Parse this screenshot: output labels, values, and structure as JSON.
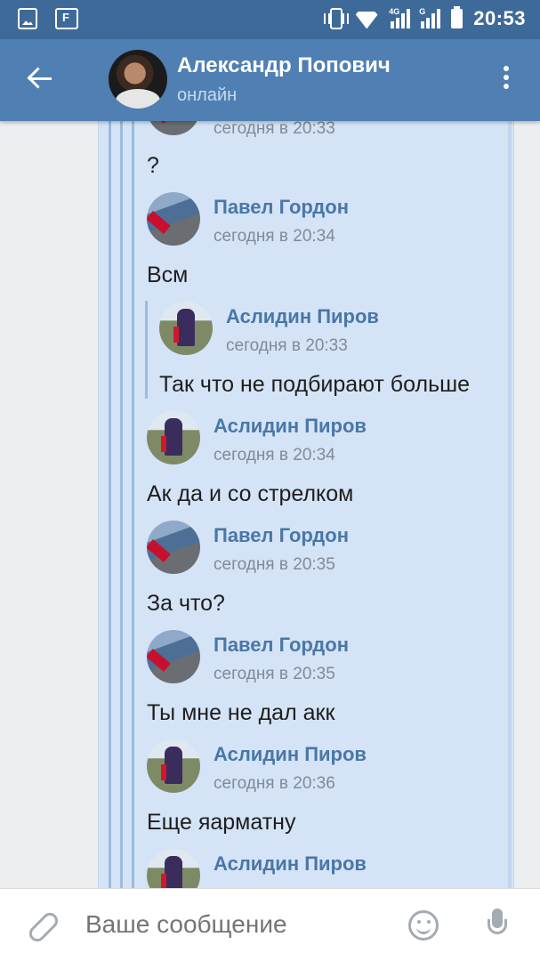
{
  "status_bar": {
    "time": "20:53",
    "network": "4G",
    "network2": "G"
  },
  "header": {
    "name": "Александр Попович",
    "status": "онлайн"
  },
  "messages": [
    {
      "author": "",
      "time": "сегодня в 20:33",
      "text": "?"
    },
    {
      "author": "Павел Гордон",
      "time": "сегодня в 20:34",
      "text": "Всм"
    },
    {
      "author": "Аслидин Пиров",
      "time": "сегодня в 20:33",
      "text": "Так что не подбирают больше"
    },
    {
      "author": "Аслидин Пиров",
      "time": "сегодня в 20:34",
      "text": "Ак да и со стрелком"
    },
    {
      "author": "Павел Гордон",
      "time": "сегодня в 20:35",
      "text": "За что?"
    },
    {
      "author": "Павел Гордон",
      "time": "сегодня в 20:35",
      "text": "Ты мне не дал акк"
    },
    {
      "author": "Аслидин Пиров",
      "time": "сегодня в 20:36",
      "text": "Еще яарматну"
    },
    {
      "author": "Аслидин Пиров",
      "time": "",
      "text": ""
    }
  ],
  "input": {
    "placeholder": "Ваше сообщение"
  }
}
